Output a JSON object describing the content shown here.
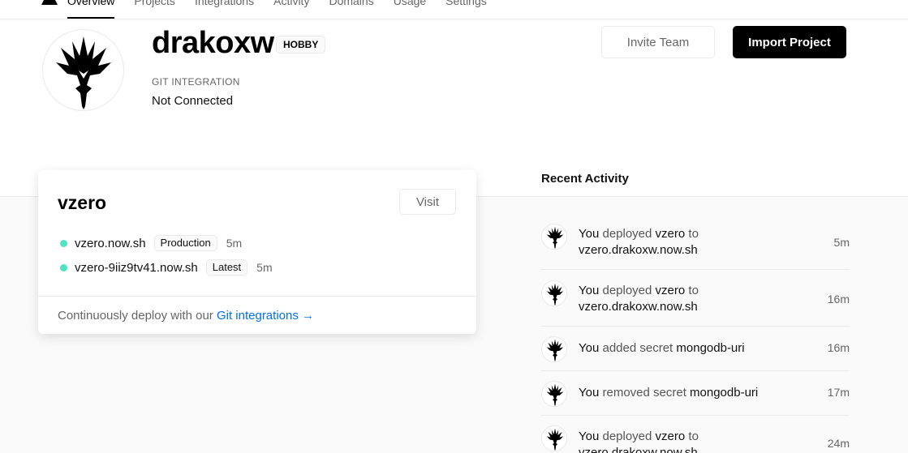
{
  "nav": {
    "tabs": [
      "Overview",
      "Projects",
      "Integrations",
      "Activity",
      "Domains",
      "Usage",
      "Settings"
    ]
  },
  "header": {
    "username": "drakoxw",
    "plan": "HOBBY",
    "git_label": "GIT INTEGRATION",
    "git_value": "Not Connected",
    "invite_label": "Invite Team",
    "import_label": "Import Project"
  },
  "project": {
    "name": "vzero",
    "visit_label": "Visit",
    "deployments": [
      {
        "url": "vzero.now.sh",
        "tag": "Production",
        "age": "5m"
      },
      {
        "url": "vzero-9iiz9tv41.now.sh",
        "tag": "Latest",
        "age": "5m"
      }
    ],
    "footer_text": "Continuously deploy with our ",
    "footer_link": "Git integrations →"
  },
  "activity": {
    "title": "Recent Activity",
    "items": [
      {
        "actor": "You",
        "verb": "deployed",
        "object": "vzero",
        "connector": "to",
        "target": "vzero.drakoxw.now.sh",
        "time": "5m"
      },
      {
        "actor": "You",
        "verb": "deployed",
        "object": "vzero",
        "connector": "to",
        "target": "vzero.drakoxw.now.sh",
        "time": "16m"
      },
      {
        "actor": "You",
        "verb": "added secret",
        "object": "mongodb-uri",
        "time": "16m"
      },
      {
        "actor": "You",
        "verb": "removed secret",
        "object": "mongodb-uri",
        "time": "17m"
      },
      {
        "actor": "You",
        "verb": "deployed",
        "object": "vzero",
        "connector": "to",
        "target": "vzero.drakoxw.now.sh",
        "time": "24m"
      }
    ]
  },
  "colors": {
    "accent": "#0070f3",
    "status_ready": "#50e3c2",
    "button_primary": "#000000"
  }
}
